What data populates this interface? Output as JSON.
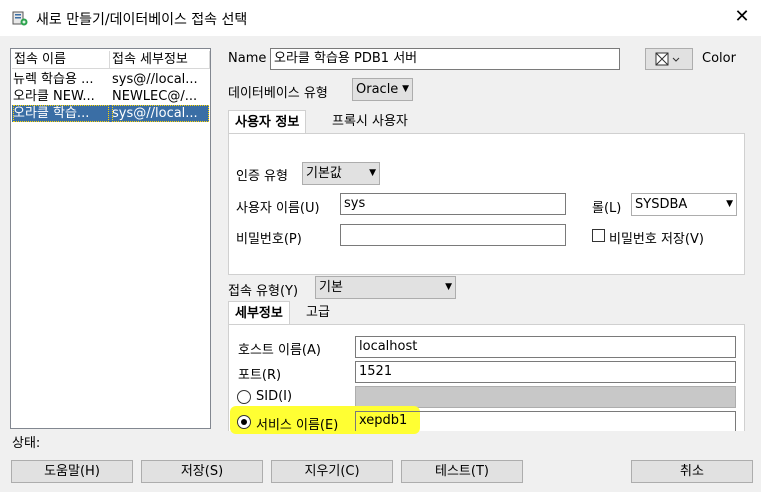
{
  "window": {
    "title": "새로 만들기/데이터베이스 접속 선택",
    "close_glyph": "✕"
  },
  "list": {
    "headers": [
      "접속 이름",
      "접속 세부정보"
    ],
    "rows": [
      {
        "name": "뉴렉 학습용 ...",
        "details": "sys@//local..."
      },
      {
        "name": "오라클 NEW...",
        "details": "NEWLEC@/..."
      },
      {
        "name": "오라클 학습...",
        "details": "sys@//local..."
      }
    ],
    "selected_index": 2
  },
  "form": {
    "name_label": "Name",
    "name_value": "오라클 학습용 PDB1 서버",
    "color_label": "Color",
    "db_type_label": "데이터베이스 유형",
    "db_type_value": "Oracle",
    "tabs": [
      "사용자 정보",
      "프록시 사용자"
    ],
    "auth_type_label": "인증 유형",
    "auth_type_value": "기본값",
    "username_label": "사용자 이름(U)",
    "username_value": "sys",
    "role_label": "롤(L)",
    "role_value": "SYSDBA",
    "password_label": "비밀번호(P)",
    "password_value": "",
    "save_password_label": "비밀번호 저장(V)",
    "conn_type_label": "접속 유형(Y)",
    "conn_type_value": "기본",
    "detail_tabs": [
      "세부정보",
      "고급"
    ],
    "host_label": "호스트 이름(A)",
    "host_value": "localhost",
    "port_label": "포트(R)",
    "port_value": "1521",
    "sid_label": "SID(I)",
    "sid_value": "",
    "service_label": "서비스 이름(E)",
    "service_value": "xepdb1"
  },
  "status_label": "상태:",
  "buttons": {
    "help": "도움말(H)",
    "save": "저장(S)",
    "clear": "지우기(C)",
    "test": "테스트(T)",
    "cancel": "취소"
  },
  "colors": {
    "selection": "#3a6ea5",
    "highlight": "#ffff33"
  }
}
